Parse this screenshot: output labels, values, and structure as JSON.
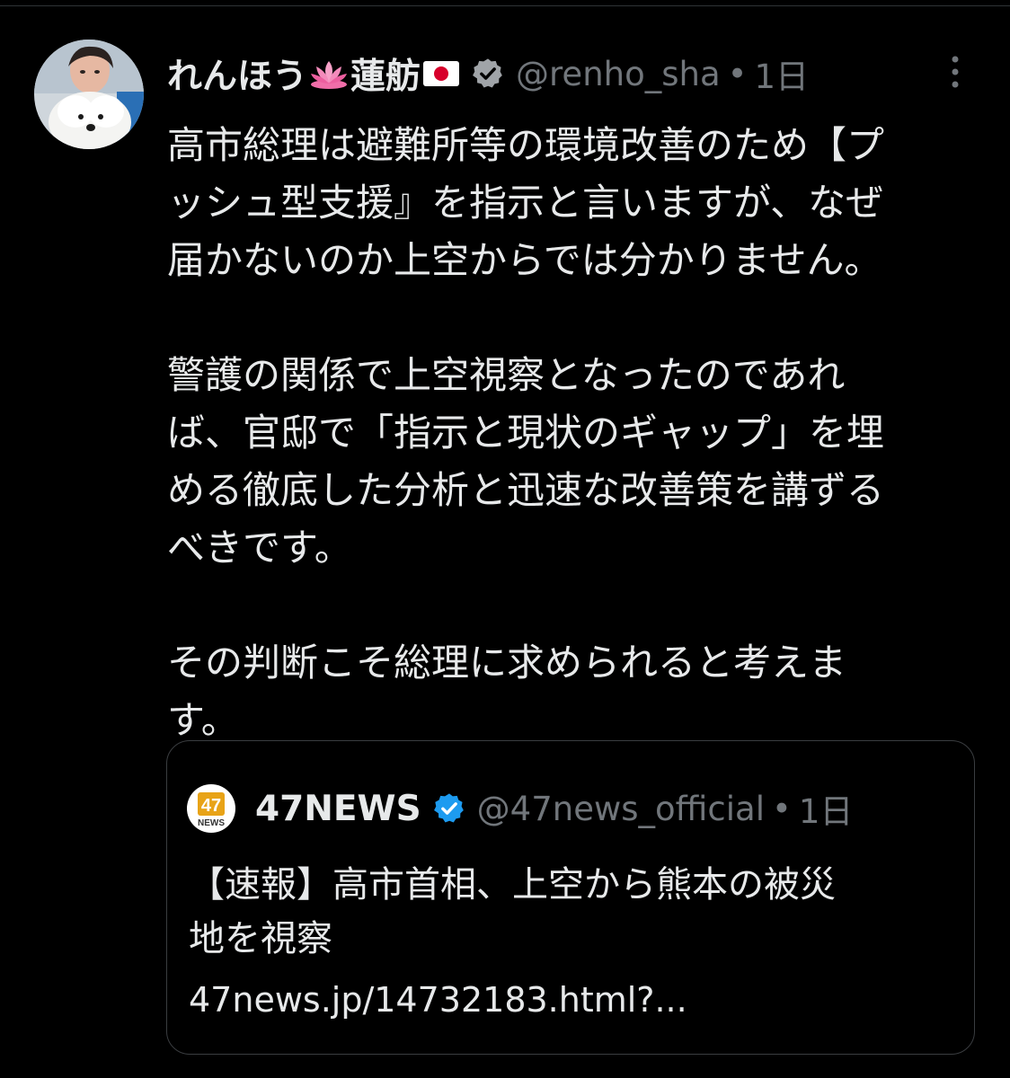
{
  "tweet": {
    "display_name": "れんほう",
    "display_name_suffix": "蓮舫",
    "emojis": [
      "lotus-emoji",
      "japan-flag-emoji"
    ],
    "handle": "@renho_sha",
    "separator": "•",
    "time": "1日",
    "paragraphs": [
      "高市総理は避難所等の環境改善のため【プ\nッシュ型支援』を指示と言いますが、なぜ\n届かないのか上空からでは分かりません。",
      "警護の関係で上空視察となったのであれ\nば、官邸で「指示と現状のギャップ」を埋\nめる徹底した分析と迅速な改善策を講ずる\nべきです。",
      "その判断こそ総理に求められると考えま\nす。"
    ]
  },
  "quote": {
    "avatar_text_top": "47",
    "avatar_text_bottom": "NEWS",
    "display_name": "47NEWS",
    "handle": "@47news_official",
    "separator": "•",
    "time": "1日",
    "text": "【速報】高市首相、上空から熊本の被災\n地を視察",
    "link": "47news.jp/14732183.html?..."
  },
  "colors": {
    "background": "#000000",
    "text": "#e7e9ea",
    "secondary": "#71767b",
    "verified": "#1d9bf0",
    "border": "#3a3d40",
    "brand_47": "#e8a317"
  }
}
